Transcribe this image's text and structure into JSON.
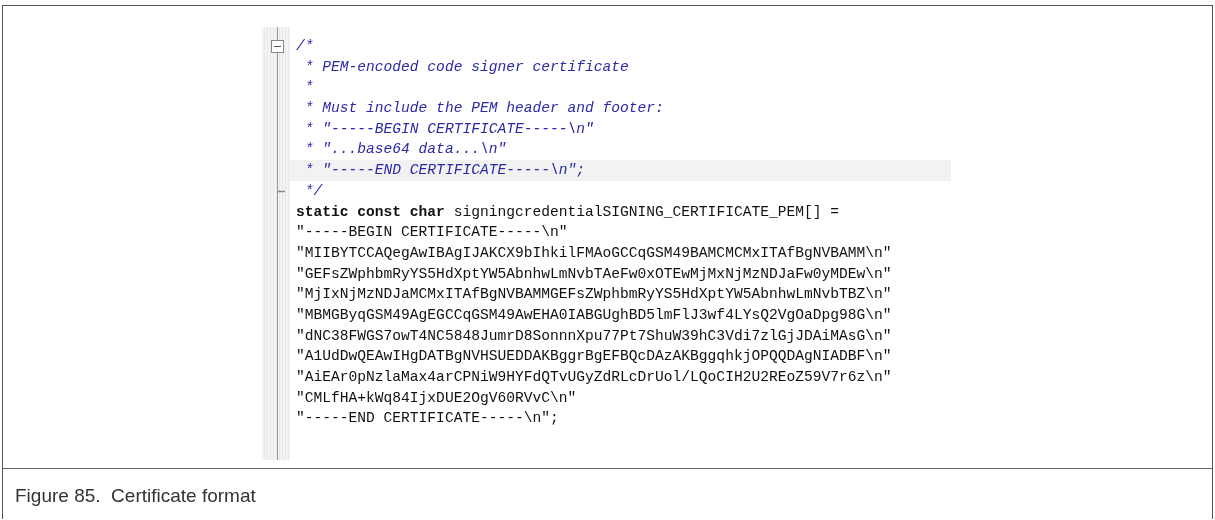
{
  "editor": {
    "lines": [
      {
        "kind": "comment",
        "text": "/*",
        "fold_start": true,
        "highlighted": false
      },
      {
        "kind": "comment",
        "text": " * PEM-encoded code signer certificate",
        "highlighted": false
      },
      {
        "kind": "comment",
        "text": " *",
        "highlighted": false
      },
      {
        "kind": "comment",
        "text": " * Must include the PEM header and footer:",
        "highlighted": false
      },
      {
        "kind": "comment",
        "text": " * \"-----BEGIN CERTIFICATE-----\\n\"",
        "highlighted": false
      },
      {
        "kind": "comment",
        "text": " * \"...base64 data...\\n\"",
        "highlighted": false
      },
      {
        "kind": "comment",
        "text": " * \"-----END CERTIFICATE-----\\n\";",
        "highlighted": true
      },
      {
        "kind": "comment",
        "text": " */",
        "fold_end": true,
        "highlighted": false
      },
      {
        "kind": "code",
        "text": "**static const char** signingcredentialSIGNING_CERTIFICATE_PEM[] =",
        "highlighted": false
      },
      {
        "kind": "code",
        "text": "\"-----BEGIN CERTIFICATE-----\\n\"",
        "highlighted": false
      },
      {
        "kind": "code",
        "text": "\"MIIBYTCCAQegAwIBAgIJAKCX9bIhkilFMAoGCCqGSM49BAMCMCMxITAfBgNVBAMM\\n\"",
        "highlighted": false
      },
      {
        "kind": "code",
        "text": "\"GEFsZWphbmRyYS5HdXptYW5AbnhwLmNvbTAeFw0xOTEwMjMxNjMzNDJaFw0yMDEw\\n\"",
        "highlighted": false
      },
      {
        "kind": "code",
        "text": "\"MjIxNjMzNDJaMCMxITAfBgNVBAMMGEFsZWphbmRyYS5HdXptYW5AbnhwLmNvbTBZ\\n\"",
        "highlighted": false
      },
      {
        "kind": "code",
        "text": "\"MBMGByqGSM49AgEGCCqGSM49AwEHA0IABGUghBD5lmFlJ3wf4LYsQ2VgOaDpg98G\\n\"",
        "highlighted": false
      },
      {
        "kind": "code",
        "text": "\"dNC38FWGS7owT4NC5848JumrD8SonnnXpu77Pt7ShuW39hC3Vdi7zlGjJDAiMAsG\\n\"",
        "highlighted": false
      },
      {
        "kind": "code",
        "text": "\"A1UdDwQEAwIHgDATBgNVHSUEDDAKBggrBgEFBQcDAzAKBggqhkjOPQQDAgNIADBF\\n\"",
        "highlighted": false
      },
      {
        "kind": "code",
        "text": "\"AiEAr0pNzlaMax4arCPNiW9HYFdQTvUGyZdRLcDrUol/LQoCIH2U2REoZ59V7r6z\\n\"",
        "highlighted": false
      },
      {
        "kind": "code",
        "text": "\"CMLfHA+kWq84IjxDUE2OgV60RVvC\\n\"",
        "highlighted": false
      },
      {
        "kind": "code",
        "text": "\"-----END CERTIFICATE-----\\n\";",
        "highlighted": false
      }
    ]
  },
  "caption": "Figure 85.  Certificate format"
}
